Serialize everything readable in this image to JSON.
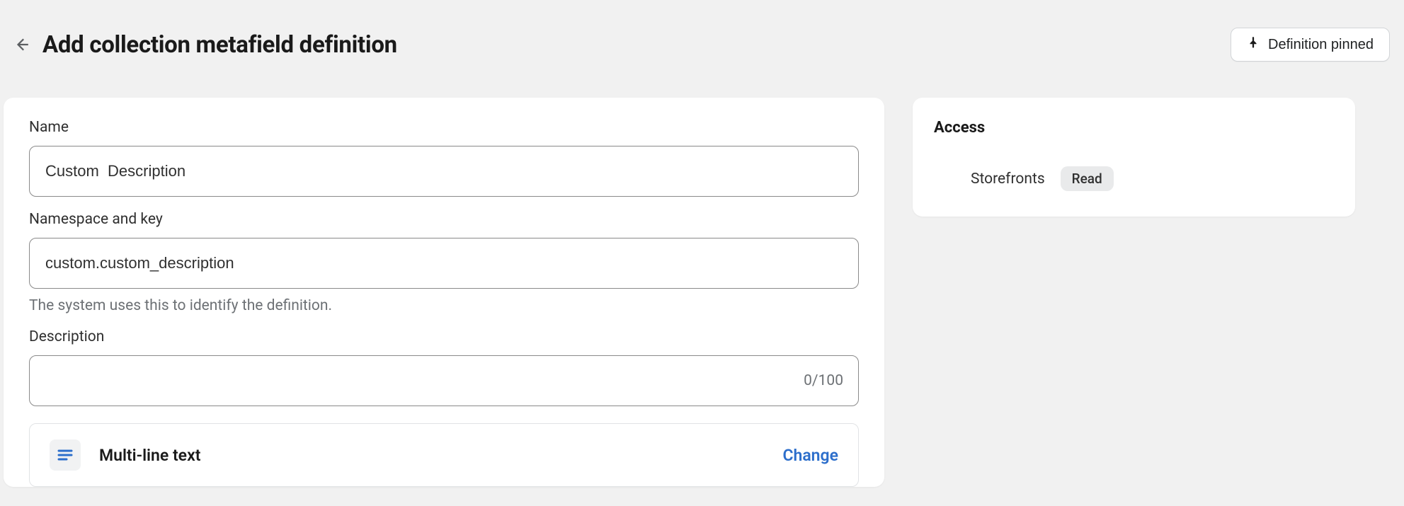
{
  "header": {
    "title": "Add collection metafield definition",
    "pinned_label": "Definition pinned"
  },
  "form": {
    "name_label": "Name",
    "name_value": "Custom  Description",
    "namespace_label": "Namespace and key",
    "namespace_value": "custom.custom_description",
    "namespace_helper": "The system uses this to identify the definition.",
    "description_label": "Description",
    "description_value": "",
    "description_counter": "0/100",
    "type": {
      "label": "Multi-line text",
      "change": "Change"
    }
  },
  "sidebar": {
    "access_heading": "Access",
    "storefronts_label": "Storefronts",
    "storefronts_badge": "Read"
  }
}
